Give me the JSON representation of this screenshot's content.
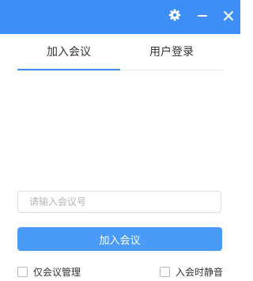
{
  "titlebar": {
    "color": "#3d8ef6",
    "icons": [
      "gear-icon",
      "minimize-icon",
      "close-icon"
    ]
  },
  "tabs": [
    {
      "label": "加入会议",
      "active": true
    },
    {
      "label": "用户登录",
      "active": false
    }
  ],
  "accent": "#3d8ef6",
  "meeting_input": {
    "value": "",
    "placeholder": "请输入会议号"
  },
  "join_button": {
    "label": "加入会议",
    "color": "#4a9bf7"
  },
  "options": [
    {
      "label": "仅会议管理",
      "checked": false
    },
    {
      "label": "入会时静音",
      "checked": false
    }
  ]
}
